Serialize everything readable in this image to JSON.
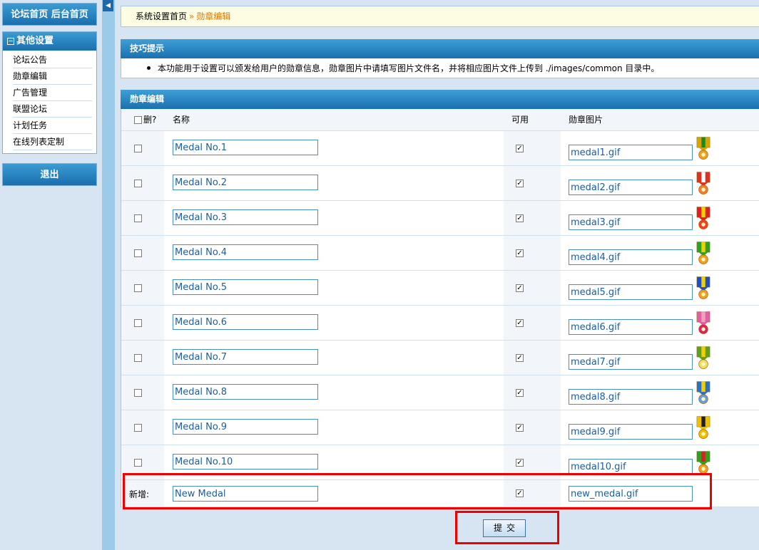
{
  "nav": {
    "top_label": "论坛首页 后台首页",
    "section_title": "其他设置",
    "section_toggle": "−",
    "items": [
      "论坛公告",
      "勋章编辑",
      "广告管理",
      "联盟论坛",
      "计划任务",
      "在线列表定制"
    ],
    "logout_label": "退出",
    "splitter_arrow": "◀"
  },
  "breadcrumb": {
    "home": "系统设置首页",
    "separator": "»",
    "current": "勋章编辑"
  },
  "tips": {
    "title": "技巧提示",
    "text": "本功能用于设置可以颁发给用户的勋章信息，勋章图片中请填写图片文件名，并将相应图片文件上传到 ./images/common 目录中。"
  },
  "medal_editor": {
    "title": "勋章编辑",
    "columns": {
      "delete": "删?",
      "name": "名称",
      "available": "可用",
      "image": "勋章图片"
    },
    "rows": [
      {
        "name": "Medal No.1",
        "available": true,
        "image": "medal1.gif",
        "ribbon": "#d9a400",
        "stripe": "#1a8a1a",
        "charm": "#f0a020"
      },
      {
        "name": "Medal No.2",
        "available": true,
        "image": "medal2.gif",
        "ribbon": "#e03020",
        "stripe": "#ffffff",
        "charm": "#f08030"
      },
      {
        "name": "Medal No.3",
        "available": true,
        "image": "medal3.gif",
        "ribbon": "#e02020",
        "stripe": "#f0d000",
        "charm": "#f04020"
      },
      {
        "name": "Medal No.4",
        "available": true,
        "image": "medal4.gif",
        "ribbon": "#30a020",
        "stripe": "#f0d000",
        "charm": "#f0a020"
      },
      {
        "name": "Medal No.5",
        "available": true,
        "image": "medal5.gif",
        "ribbon": "#2050c0",
        "stripe": "#f0d000",
        "charm": "#f0a020"
      },
      {
        "name": "Medal No.6",
        "available": true,
        "image": "medal6.gif",
        "ribbon": "#e060a0",
        "stripe": "#f0a0c0",
        "charm": "#e02060"
      },
      {
        "name": "Medal No.7",
        "available": true,
        "image": "medal7.gif",
        "ribbon": "#60a020",
        "stripe": "#f0d000",
        "charm": "#f0e060"
      },
      {
        "name": "Medal No.8",
        "available": true,
        "image": "medal8.gif",
        "ribbon": "#3070c0",
        "stripe": "#f0d000",
        "charm": "#60a0e0"
      },
      {
        "name": "Medal No.9",
        "available": true,
        "image": "medal9.gif",
        "ribbon": "#f0c000",
        "stripe": "#202020",
        "charm": "#f0c000"
      },
      {
        "name": "Medal No.10",
        "available": true,
        "image": "medal10.gif",
        "ribbon": "#30a020",
        "stripe": "#e02020",
        "charm": "#f0a020"
      }
    ],
    "new_row": {
      "label": "新增:",
      "name": "New Medal",
      "available": true,
      "image": "new_medal.gif"
    },
    "submit_label": "提交"
  },
  "colors": {
    "highlight": "#ee0000",
    "header_blue": "#1a70b0"
  }
}
